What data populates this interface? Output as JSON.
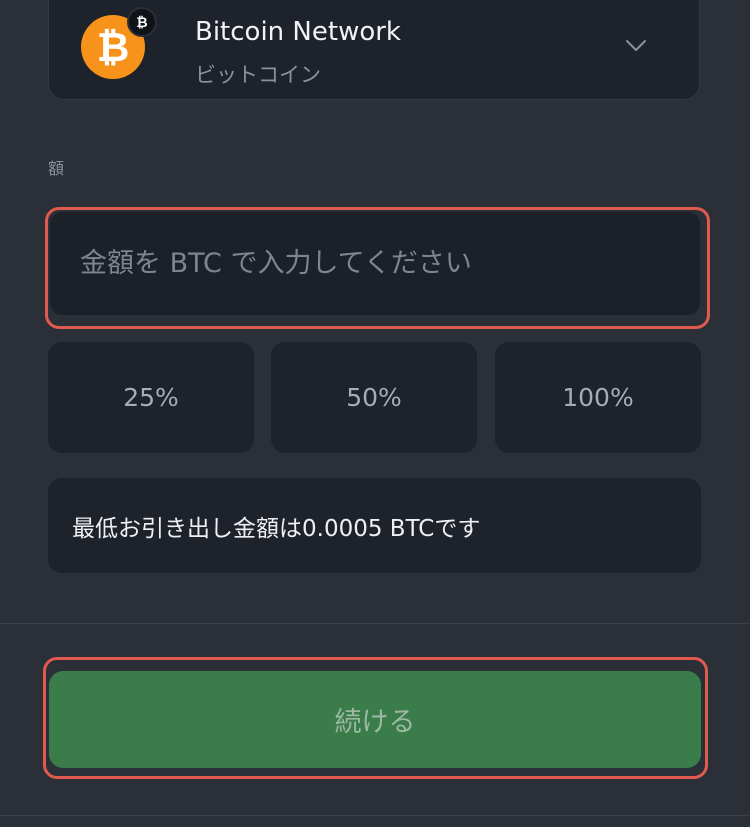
{
  "network": {
    "name": "Bitcoin Network",
    "subtitle": "ビットコイン",
    "coin_icon": "bitcoin-icon",
    "coin_color": "#f7931a",
    "dropdown_icon": "chevron-down-icon"
  },
  "amount": {
    "label": "額",
    "placeholder": "金額を BTC で入力してください",
    "value": ""
  },
  "percent_buttons": [
    {
      "label": "25%"
    },
    {
      "label": "50%"
    },
    {
      "label": "100%"
    }
  ],
  "min_withdrawal_text": "最低お引き出し金額は0.0005 BTCです",
  "continue_button": {
    "label": "続ける",
    "color": "#3a7d4a"
  },
  "highlight_color": "#e05a4f"
}
